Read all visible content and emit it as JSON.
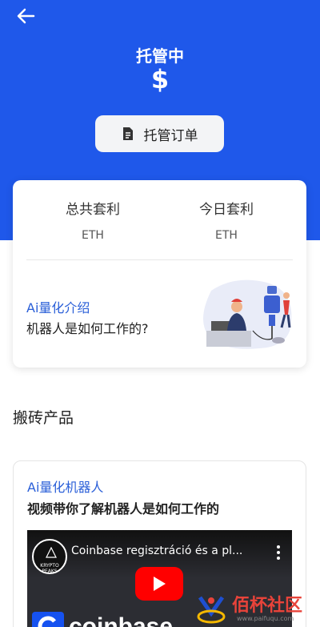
{
  "header": {
    "title": "托管中",
    "symbol": "$",
    "order_button_label": "托管订单"
  },
  "stats": {
    "total_profit_label": "总共套利",
    "total_profit_unit": "ETH",
    "today_profit_label": "今日套利",
    "today_profit_unit": "ETH"
  },
  "intro": {
    "link_text": "Ai量化介绍",
    "subtitle": "机器人是如何工作的?"
  },
  "products": {
    "section_title": "搬砖产品",
    "card_link": "Ai量化机器人",
    "card_title": "视频带你了解机器人是如何工作的",
    "video_title": "Coinbase regisztráció és a pl...",
    "channel_name": "KRYPTO PEAKS",
    "brand_text": "coinbase"
  },
  "watermark": {
    "site_name": "佰杯社区",
    "url": "www.paifuqu.com"
  },
  "colors": {
    "primary": "#1f58ea",
    "link": "#2a5fd8",
    "youtube_red": "#ff0000",
    "coinbase_blue": "#1652f0"
  },
  "icons": [
    "back-arrow-icon",
    "document-icon",
    "robot-illustration",
    "play-icon",
    "more-vert-icon",
    "coinbase-logo-icon",
    "watermark-logo-icon"
  ]
}
